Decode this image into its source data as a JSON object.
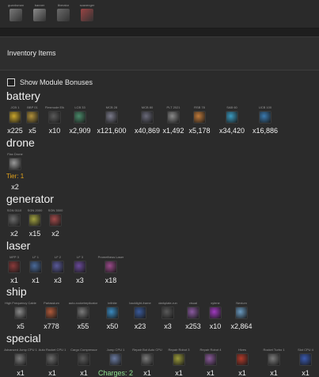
{
  "top_strip": {
    "items": [
      {
        "label": "guardsman",
        "icon": "robot-icon",
        "color": "#7a7a7a"
      },
      {
        "label": "banner",
        "icon": "banner-icon",
        "color": "#8a8a8a"
      },
      {
        "label": "liberator",
        "icon": "ship-icon",
        "color": "#6a6a6a"
      },
      {
        "label": "scavenger",
        "icon": "scavenger-icon",
        "color": "#9a4444"
      }
    ]
  },
  "panel": {
    "title": "Inventory Items",
    "toggle_label": "Show Module Bonuses"
  },
  "categories": {
    "battery": {
      "title": "battery",
      "items": [
        {
          "label": "JCB 1",
          "count": "x225",
          "icon": "battery-icon",
          "color": "#c9a52b"
        },
        {
          "label": "BBP 01",
          "count": "x5",
          "icon": "battery-icon",
          "color": "#b0903a"
        },
        {
          "label": "Flexmode Elk",
          "count": "x10",
          "icon": "battery-icon",
          "color": "#5a5a5a"
        },
        {
          "label": "LCB 33",
          "count": "x2,909",
          "icon": "battery-icon",
          "color": "#4a8a6a"
        },
        {
          "label": "MCB 28",
          "count": "x121,600",
          "icon": "battery-icon",
          "color": "#7a7a8a"
        },
        {
          "label": "MCB 80",
          "count": "x40,869",
          "icon": "battery-icon",
          "color": "#6a6a7a"
        },
        {
          "label": "PLT 2021",
          "count": "x1,492",
          "icon": "battery-icon",
          "color": "#8a8a8a"
        },
        {
          "label": "RSB 78",
          "count": "x5,178",
          "icon": "battery-icon",
          "color": "#c07a3a"
        },
        {
          "label": "SAB 60",
          "count": "x34,420",
          "icon": "battery-icon",
          "color": "#3a9ac0"
        },
        {
          "label": "UCB 100",
          "count": "x16,886",
          "icon": "battery-icon",
          "color": "#3a7ab0"
        }
      ]
    },
    "drone": {
      "title": "drone",
      "items": [
        {
          "label": "Flax Drone",
          "tier": "Tier: 1",
          "count": "x2",
          "icon": "drone-icon",
          "color": "#9a9a9a"
        }
      ]
    },
    "generator": {
      "title": "generator",
      "items": [
        {
          "label": "SGN 0110",
          "count": "x2",
          "icon": "generator-icon",
          "color": "#6a6a6a"
        },
        {
          "label": "SGN 2000",
          "count": "x15",
          "icon": "generator-icon",
          "color": "#a0a040"
        },
        {
          "label": "SGN 3500",
          "count": "x2",
          "icon": "generator-icon",
          "color": "#a04a4a"
        }
      ]
    },
    "laser": {
      "title": "laser",
      "items": [
        {
          "label": "MFP 3",
          "count": "x1",
          "icon": "laser-icon",
          "color": "#8a3a3a"
        },
        {
          "label": "LF 1",
          "count": "x1",
          "icon": "laser-icon",
          "color": "#4a6a9a"
        },
        {
          "label": "LF 2",
          "count": "x3",
          "icon": "laser-icon",
          "color": "#5a5a9a"
        },
        {
          "label": "LF 3",
          "count": "x3",
          "icon": "laser-icon",
          "color": "#6a4a9a"
        },
        {
          "label": "Prometheus Laser",
          "count": "x18",
          "icon": "laser-icon",
          "color": "#9a4a8a"
        }
      ]
    },
    "ship": {
      "title": "ship",
      "items": [
        {
          "label": "High Frequency Cable",
          "count": "x5",
          "icon": "cable-icon",
          "color": "#8a8a8a"
        },
        {
          "label": "Parlassium",
          "count": "x778",
          "icon": "ore-icon",
          "color": "#b05a3a"
        },
        {
          "label": "auto-rocketreplicator",
          "count": "x55",
          "icon": "replicator-icon",
          "color": "#7a7a7a"
        },
        {
          "label": "infinite",
          "count": "x50",
          "icon": "orb-icon",
          "color": "#3a8ac0"
        },
        {
          "label": "backlight-frame",
          "count": "x23",
          "icon": "frame-icon",
          "color": "#3a5a9a"
        },
        {
          "label": "darkplate-run",
          "count": "x3",
          "icon": "plate-icon",
          "color": "#5a5a5a"
        },
        {
          "label": "visual",
          "count": "x253",
          "icon": "visual-icon",
          "color": "#8a5aa0"
        },
        {
          "label": "xylene",
          "count": "x10",
          "icon": "crystal-icon",
          "color": "#a03ac0"
        },
        {
          "label": "Nexium",
          "count": "x2,864",
          "icon": "crystal-icon",
          "color": "#6a9ac0"
        }
      ]
    },
    "special": {
      "title": "special",
      "items": [
        {
          "label": "Advanced Jump CPU 1",
          "count": "x1",
          "icon": "cpu-icon",
          "color": "#7a7a7a"
        },
        {
          "label": "Auto Rocket CPU 1",
          "count": "x1",
          "icon": "cpu-icon",
          "color": "#6a6a6a"
        },
        {
          "label": "Cargo Compressor",
          "count": "x1",
          "icon": "compressor-icon",
          "color": "#5a5a5a"
        },
        {
          "label": "Jump CPU 1",
          "charges": "Charges: 2",
          "icon": "cpu-icon",
          "color": "#6a7aa0"
        },
        {
          "label": "Repair Bot Auto CPU",
          "count": "x1",
          "icon": "cpu-icon",
          "color": "#7a7a7a"
        },
        {
          "label": "Repair Robot 3",
          "count": "x1",
          "icon": "robot-icon",
          "color": "#9a9a3a"
        },
        {
          "label": "Repair Robot 4",
          "count": "x1",
          "icon": "robot-icon",
          "color": "#8a5a9a"
        },
        {
          "label": "Hives",
          "count": "x1",
          "icon": "hive-icon",
          "color": "#b03a2a"
        },
        {
          "label": "Rocket Turbo 1",
          "count": "x1",
          "icon": "rocket-icon",
          "color": "#7a7a7a"
        },
        {
          "label": "Slot CPU 4",
          "count": "x1",
          "icon": "cpu-icon",
          "color": "#3a5ab0"
        }
      ]
    }
  }
}
